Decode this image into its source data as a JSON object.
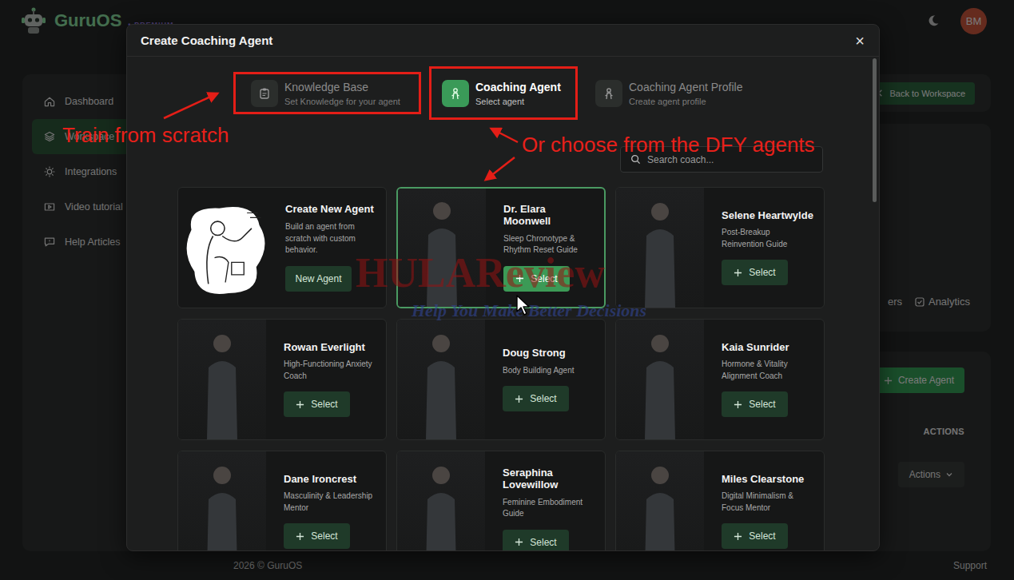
{
  "app": {
    "logo": "GuruOS",
    "badge": "• PREMIUM",
    "avatar": "BM"
  },
  "sidebar": {
    "items": [
      {
        "label": "Dashboard",
        "selected": false
      },
      {
        "label": "Workspace",
        "selected": true
      },
      {
        "label": "Integrations",
        "selected": false
      },
      {
        "label": "Video tutorial",
        "selected": false
      },
      {
        "label": "Help Articles",
        "selected": false
      }
    ]
  },
  "workspace": {
    "back_button": "Back to Workspace",
    "tabs": [
      {
        "label": "ers",
        "kind": "cut"
      },
      {
        "label": "Analytics",
        "kind": "tab"
      }
    ],
    "create_button": "Create Agent",
    "column": "ACTIONS",
    "actions_button": "Actions"
  },
  "footer": {
    "copyright": "2026 ©  GuruOS",
    "support": "Support"
  },
  "modal": {
    "title": "Create Coaching Agent",
    "close": "×",
    "steps": [
      {
        "title": "Knowledge Base",
        "subtitle": "Set Knowledge for your agent",
        "selected": false,
        "annotated": true
      },
      {
        "title": "Coaching Agent",
        "subtitle": "Select agent",
        "selected": true,
        "annotated": true
      },
      {
        "title": "Coaching Agent Profile",
        "subtitle": "Create agent profile",
        "selected": false,
        "annotated": false
      }
    ],
    "search": {
      "placeholder": "Search coach..."
    },
    "create_card": {
      "title": "Create New Agent",
      "description": "Build an agent from scratch with custom behavior.",
      "button": "New Agent"
    },
    "agents": [
      {
        "name": "Dr. Elara Moonwell",
        "role": "Sleep Chronotype & Rhythm Reset Guide",
        "button": "Select",
        "selected": true
      },
      {
        "name": "Selene Heartwylde",
        "role": "Post-Breakup Reinvention Guide",
        "button": "Select",
        "selected": false
      },
      {
        "name": "Rowan Everlight",
        "role": "High-Functioning Anxiety Coach",
        "button": "Select",
        "selected": false
      },
      {
        "name": "Doug Strong",
        "role": "Body Building Agent",
        "button": "Select",
        "selected": false
      },
      {
        "name": "Kaia Sunrider",
        "role": "Hormone & Vitality Alignment Coach",
        "button": "Select",
        "selected": false
      },
      {
        "name": "Dane Ironcrest",
        "role": "Masculinity & Leadership Mentor",
        "button": "Select",
        "selected": false
      },
      {
        "name": "Seraphina Lovewillow",
        "role": "Feminine Embodiment Guide",
        "button": "Select",
        "selected": false
      },
      {
        "name": "Miles Clearstone",
        "role": "Digital Minimalism & Focus Mentor",
        "button": "Select",
        "selected": false
      }
    ]
  },
  "annotations": {
    "left": "Train from scratch",
    "right": "Or choose from the DFY agents"
  },
  "watermark": {
    "title": "HULAReview",
    "subtitle": "Help You Make Better Decisions"
  }
}
